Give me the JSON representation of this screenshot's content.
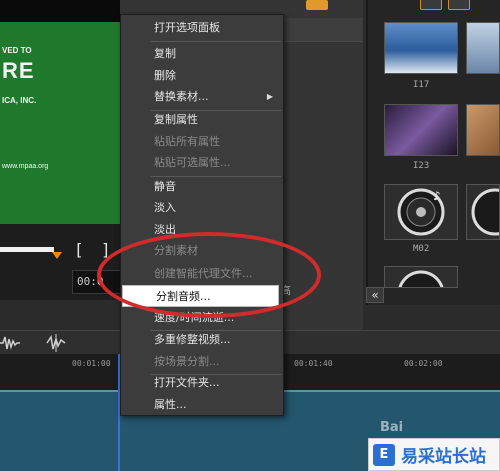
{
  "preview": {
    "line1": "VED TO",
    "line2": "RE",
    "line3": "ICA, INC.",
    "line4": "www.mpaa.org",
    "timecode": "00:0"
  },
  "middle": {
    "partial_text": "高"
  },
  "library": {
    "thumbs": [
      {
        "label": "I17"
      },
      {
        "label": "I23"
      },
      {
        "label": "M02"
      }
    ],
    "collapse": "«"
  },
  "timeline": {
    "ticks": [
      "00:01:00",
      "00:01:40",
      "00:02:00"
    ]
  },
  "context_menu": {
    "items": [
      {
        "label": "打开选项面板",
        "enabled": true
      },
      {
        "label": "复制",
        "enabled": true
      },
      {
        "label": "删除",
        "enabled": true
      },
      {
        "label": "替换素材...",
        "enabled": true,
        "submenu": true
      },
      {
        "label": "复制属性",
        "enabled": true
      },
      {
        "label": "粘贴所有属性",
        "enabled": false
      },
      {
        "label": "粘贴可选属性...",
        "enabled": false
      },
      {
        "label": "静音",
        "enabled": true
      },
      {
        "label": "淡入",
        "enabled": true
      },
      {
        "label": "淡出",
        "enabled": true
      },
      {
        "label": "分割素材",
        "enabled": false
      },
      {
        "label": "创建智能代理文件...",
        "enabled": false
      },
      {
        "label": "分割音频...",
        "enabled": true,
        "highlighted": true
      },
      {
        "label": "速度/时间流逝...",
        "enabled": true
      },
      {
        "label": "多重修整视频...",
        "enabled": true
      },
      {
        "label": "按场景分割...",
        "enabled": false
      },
      {
        "label": "打开文件夹...",
        "enabled": true
      },
      {
        "label": "属性...",
        "enabled": true
      }
    ]
  },
  "watermarks": {
    "baidu": "Bai",
    "site": "易采站长站",
    "site_logo": "E"
  },
  "colors": {
    "highlight": "#ffffff",
    "annotation": "#d22b2b",
    "preview_green": "#1f7a2e",
    "accent": "#e88a1a"
  }
}
